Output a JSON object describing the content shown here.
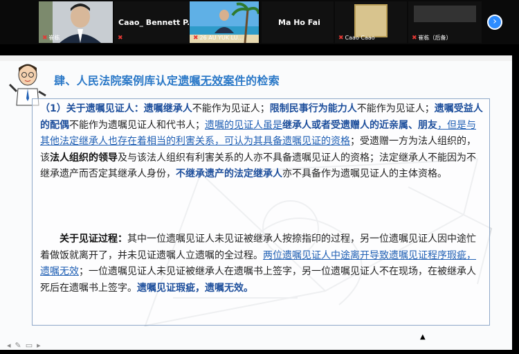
{
  "gallery": {
    "tiles": [
      {
        "name": "崔栋",
        "muted": true
      },
      {
        "name": "Caao_ Bennett P...",
        "muted": true,
        "video": false
      },
      {
        "name": "26 AU YUK LU...",
        "muted": true
      },
      {
        "name": "Ma Ho Fai",
        "muted": false,
        "video": false
      },
      {
        "name": "Caao Caao",
        "muted": true
      },
      {
        "name": "崔栋（后备）",
        "muted": true
      }
    ],
    "next_icon": "chevron-right-icon"
  },
  "slide": {
    "title_prefix": "肆、人民法院案例库认定",
    "title_underlined": "遗嘱无效案件",
    "title_suffix": "的检索",
    "p1": [
      {
        "t": "（1）关于遗嘱见证人：",
        "s": "b"
      },
      {
        "t": "遗嘱继承人",
        "s": "b"
      },
      {
        "t": "不能作为见证人；",
        "s": ""
      },
      {
        "t": "限制民事行为能力人",
        "s": "b"
      },
      {
        "t": "不能作为见证人；",
        "s": ""
      },
      {
        "t": "遗嘱受益人的配偶",
        "s": "b"
      },
      {
        "t": "不能作为遗嘱见证人和代书人；",
        "s": ""
      },
      {
        "t": "遗嘱的见证人虽是",
        "s": "ul"
      },
      {
        "t": "继承人或者受遗赠人的近亲属、朋友",
        "s": "b"
      },
      {
        "t": "，但是与其他法定继承人也存在着相当的利害关系，可认为其具备遗嘱见证的资格",
        "s": "ul"
      },
      {
        "t": "；受遗赠一方为法人组织的，该",
        "s": ""
      },
      {
        "t": "法人组织的领导",
        "s": "bk"
      },
      {
        "t": "及与该法人组织有利害关系的人亦不具备遗嘱见证人的资格；法定继承人不能因为不继承遗产而否定其继承人身份，",
        "s": ""
      },
      {
        "t": "不继承遗产的法定继承人",
        "s": "b"
      },
      {
        "t": "亦不具备作为遗嘱见证人的主体资格。",
        "s": ""
      }
    ],
    "p2": [
      {
        "t": "关于见证过程：",
        "s": "bk"
      },
      {
        "t": "其中一位遗嘱见证人未见证被继承人按捺指印的过程，另一位遗嘱见证人因中途忙着做饭就离开了，并未见证遗嘱人立遗嘱的全过程。",
        "s": ""
      },
      {
        "t": "两位遗嘱见证人中途离开导致遗嘱见证程序瑕疵，遗嘱无效",
        "s": "ul"
      },
      {
        "t": "；一位遗嘱见证人未见证被继承人在遗嘱书上签字，另一位遗嘱见证人不在现场，在被继承人死后在遗嘱书上签字。",
        "s": ""
      },
      {
        "t": "遗嘱见证瑕疵，遗嘱无效。",
        "s": "b"
      }
    ]
  },
  "colors": {
    "accent": "#2d8cff",
    "title": "#2a78c7",
    "emphasis": "#1e4f9c",
    "muted_mic": "#e53935"
  },
  "annotation_tools": [
    "arrow-icon",
    "pen-icon",
    "whiteboard-icon",
    "forward-icon"
  ]
}
